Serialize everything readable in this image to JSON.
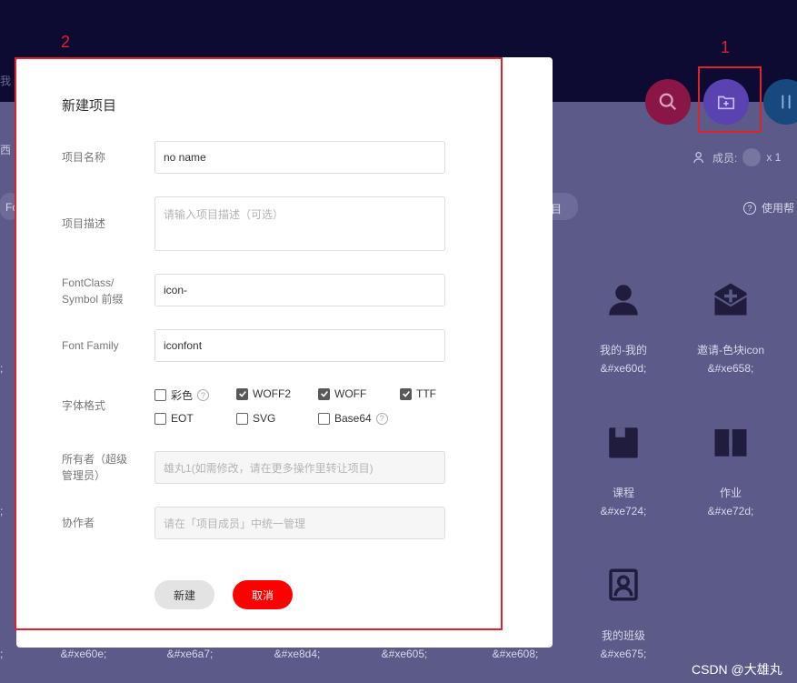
{
  "background": {
    "top_fragment": "我",
    "left_fragment": "西",
    "member_label": "成员:",
    "member_count": "x 1",
    "usage_label": "使用帮",
    "tab_fragment_left": "Fo",
    "tab_fragment_right": "目",
    "icons": [
      {
        "name": "我的-我的",
        "code": "&#xe60d;",
        "icon": "user-icon"
      },
      {
        "name": "邀请-色块icon",
        "code": "&#xe658;",
        "icon": "mail-invite-icon"
      },
      {
        "name": "课程",
        "code": "&#xe724;",
        "icon": "course-icon"
      },
      {
        "name": "作业",
        "code": "&#xe72d;",
        "icon": "homework-book-icon"
      },
      {
        "name": "我的班级",
        "code": "&#xe675;",
        "icon": "my-class-icon"
      }
    ],
    "bottom_codes": [
      "&#xe60e;",
      "&#xe6a7;",
      "&#xe8d4;",
      "&#xe605;",
      "&#xe608;"
    ],
    "left_partial_semicolons": [
      ";",
      ";",
      ";"
    ]
  },
  "annotations": {
    "label_1": "1",
    "label_2": "2"
  },
  "dialog": {
    "title": "新建项目",
    "project_name": {
      "label": "项目名称",
      "value": "no name"
    },
    "project_desc": {
      "label": "项目描述",
      "placeholder": "请输入项目描述（可选）"
    },
    "font_class": {
      "label_line1": "FontClass/",
      "label_line2": "Symbol 前缀",
      "value": "icon-"
    },
    "font_family": {
      "label": "Font Family",
      "value": "iconfont"
    },
    "font_format": {
      "label": "字体格式",
      "options": [
        {
          "label": "彩色",
          "checked": false,
          "help": true
        },
        {
          "label": "WOFF2",
          "checked": true
        },
        {
          "label": "WOFF",
          "checked": true
        },
        {
          "label": "TTF",
          "checked": true
        },
        {
          "label": "EOT",
          "checked": false
        },
        {
          "label": "SVG",
          "checked": false
        },
        {
          "label": "Base64",
          "checked": false,
          "help": true
        }
      ]
    },
    "owner": {
      "label_line1": "所有者（超级",
      "label_line2": "管理员）",
      "placeholder": "雄丸1(如需修改，请在更多操作里转让项目)"
    },
    "collaborator": {
      "label": "协作者",
      "placeholder": "请在「项目成员」中统一管理"
    },
    "buttons": {
      "create": "新建",
      "cancel": "取消"
    }
  },
  "watermark": "CSDN @大雄丸",
  "colors": {
    "accent": "#ff0000",
    "annotation": "#e0222f",
    "overlay": "#5b5a89",
    "topbar": "#0e0b33"
  }
}
